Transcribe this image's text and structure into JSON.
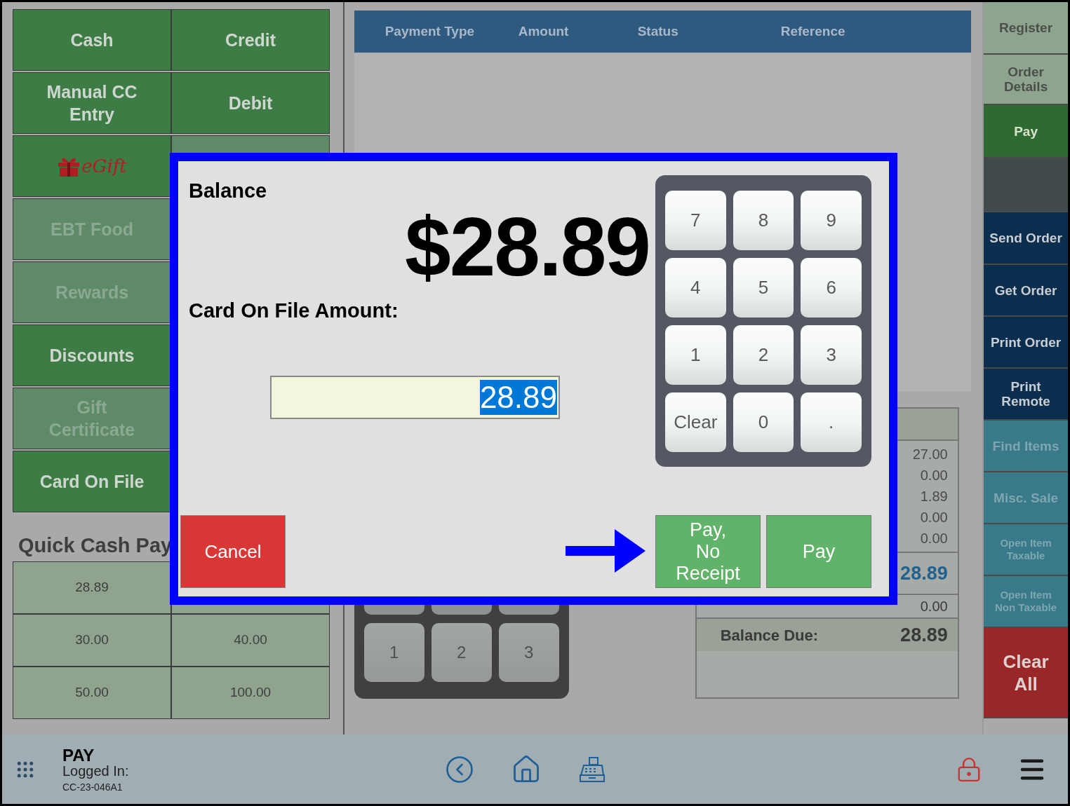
{
  "payment_methods": {
    "left": [
      {
        "label": "Cash",
        "kind": "text",
        "disabled": false
      },
      {
        "label": "Manual CC Entry",
        "kind": "text",
        "disabled": false
      },
      {
        "label": "eGift",
        "kind": "logo",
        "disabled": false
      },
      {
        "label": "EBT Food",
        "kind": "text",
        "disabled": true
      },
      {
        "label": "Rewards",
        "kind": "text",
        "disabled": true
      },
      {
        "label": "Discounts",
        "kind": "text",
        "disabled": false
      },
      {
        "label": "Gift Certificate",
        "kind": "text",
        "disabled": true
      },
      {
        "label": "Card On File",
        "kind": "text",
        "disabled": false
      }
    ],
    "right": [
      {
        "label": "Credit",
        "kind": "text",
        "disabled": false
      },
      {
        "label": "Debit",
        "kind": "text",
        "disabled": false
      },
      {
        "kind": "blank",
        "disabled": true
      }
    ]
  },
  "quick_cash": {
    "title": "Quick Cash Pay",
    "rows": [
      [
        "28.89"
      ],
      [
        "30.00",
        "40.00"
      ],
      [
        "50.00",
        "100.00"
      ]
    ]
  },
  "payments_table": {
    "columns": [
      "Payment Type",
      "Amount",
      "Status",
      "Reference"
    ]
  },
  "background_keypad": {
    "keys": [
      "1",
      "2",
      "3"
    ]
  },
  "totals": {
    "values": [
      "27.00",
      "0.00",
      "1.89",
      "0.00",
      "0.00"
    ],
    "total": "28.89",
    "paid": {
      "value": "0.00"
    },
    "balance_due": {
      "label": "Balance Due:",
      "value": "28.89"
    }
  },
  "sidebar": [
    {
      "label": "Register",
      "kind": "view",
      "selected": false,
      "disabled": false
    },
    {
      "label": "Order Details",
      "kind": "view",
      "selected": false,
      "disabled": false
    },
    {
      "label": "Pay",
      "kind": "view",
      "selected": true,
      "disabled": false
    },
    {
      "kind": "blank",
      "selected": false,
      "disabled": false
    },
    {
      "label": "Send Order",
      "kind": "action",
      "selected": false,
      "disabled": false
    },
    {
      "label": "Get Order",
      "kind": "action",
      "selected": false,
      "disabled": false
    },
    {
      "label": "Print Order",
      "kind": "action",
      "selected": false,
      "disabled": false
    },
    {
      "label": "Print Remote",
      "kind": "action",
      "selected": false,
      "disabled": false
    },
    {
      "label": "Find Items",
      "kind": "item",
      "selected": false,
      "disabled": true
    },
    {
      "label": "Misc. Sale",
      "kind": "item",
      "selected": false,
      "disabled": true
    },
    {
      "label": "Open Item Taxable",
      "kind": "item",
      "selected": false,
      "disabled": true
    },
    {
      "label": "Open Item Non Taxable",
      "kind": "item",
      "selected": false,
      "disabled": true
    },
    {
      "label": "Clear All",
      "kind": "danger",
      "selected": false,
      "disabled": false
    }
  ],
  "bottom_bar": {
    "screen": "PAY",
    "logged_in": "Logged In:",
    "terminal": "CC-23-046A1"
  },
  "dialog": {
    "balance_label": "Balance",
    "balance": "$28.89",
    "amount_label": "Card On File Amount:",
    "amount_value": "28.89",
    "value_selected": true,
    "keys": [
      "7",
      "8",
      "9",
      "4",
      "5",
      "6",
      "1",
      "2",
      "3",
      "Clear",
      "0",
      "."
    ],
    "buttons": [
      {
        "label": "Cancel",
        "kind": "cancel"
      },
      {
        "label": "Pay, No Receipt",
        "kind": "pay"
      },
      {
        "label": "Pay",
        "kind": "pay"
      }
    ]
  }
}
